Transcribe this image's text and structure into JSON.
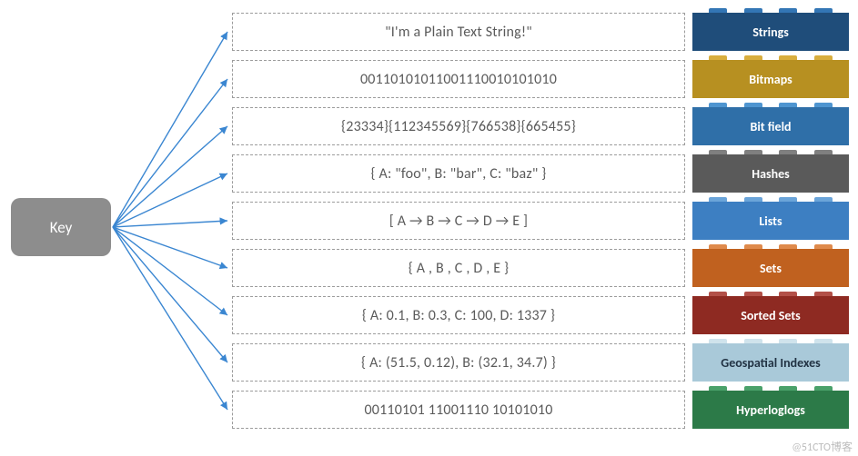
{
  "key_label": "Key",
  "watermark": "@51CTO博客",
  "rows": [
    {
      "value": "\"I'm a Plain Text String!\"",
      "type": "Strings",
      "body": "#1f4d7a",
      "stud": "#3376b5"
    },
    {
      "value": "00110101011001110010101010",
      "type": "Bitmaps",
      "body": "#b79021",
      "stud": "#d8ae3e"
    },
    {
      "value": "{23334}{112345569}{766538}{665455}",
      "type": "Bit field",
      "body": "#2f6fa8",
      "stud": "#4f95d0"
    },
    {
      "value": "{ A: \"foo\", B: \"bar\", C: \"baz\" }",
      "type": "Hashes",
      "body": "#5a5a5a",
      "stud": "#808080"
    },
    {
      "value": "[ A → B → C → D → E ]",
      "type": "Lists",
      "body": "#3d7fc2",
      "stud": "#6aa4d9"
    },
    {
      "value": "{ A , B , C , D , E }",
      "type": "Sets",
      "body": "#c0611f",
      "stud": "#df8a4c"
    },
    {
      "value": "{ A: 0.1, B: 0.3, C: 100, D: 1337 }",
      "type": "Sorted Sets",
      "body": "#8e2a22",
      "stud": "#b25048"
    },
    {
      "value": "{ A: (51.5, 0.12), B: (32.1, 34.7)  }",
      "type": "Geospatial Indexes",
      "body": "#a9c9d9",
      "stud": "#cfe3ec",
      "text": "#234"
    },
    {
      "value": "00110101 11001110 10101010",
      "type": "Hyperloglogs",
      "body": "#2c7a48",
      "stud": "#4aa16a"
    }
  ]
}
